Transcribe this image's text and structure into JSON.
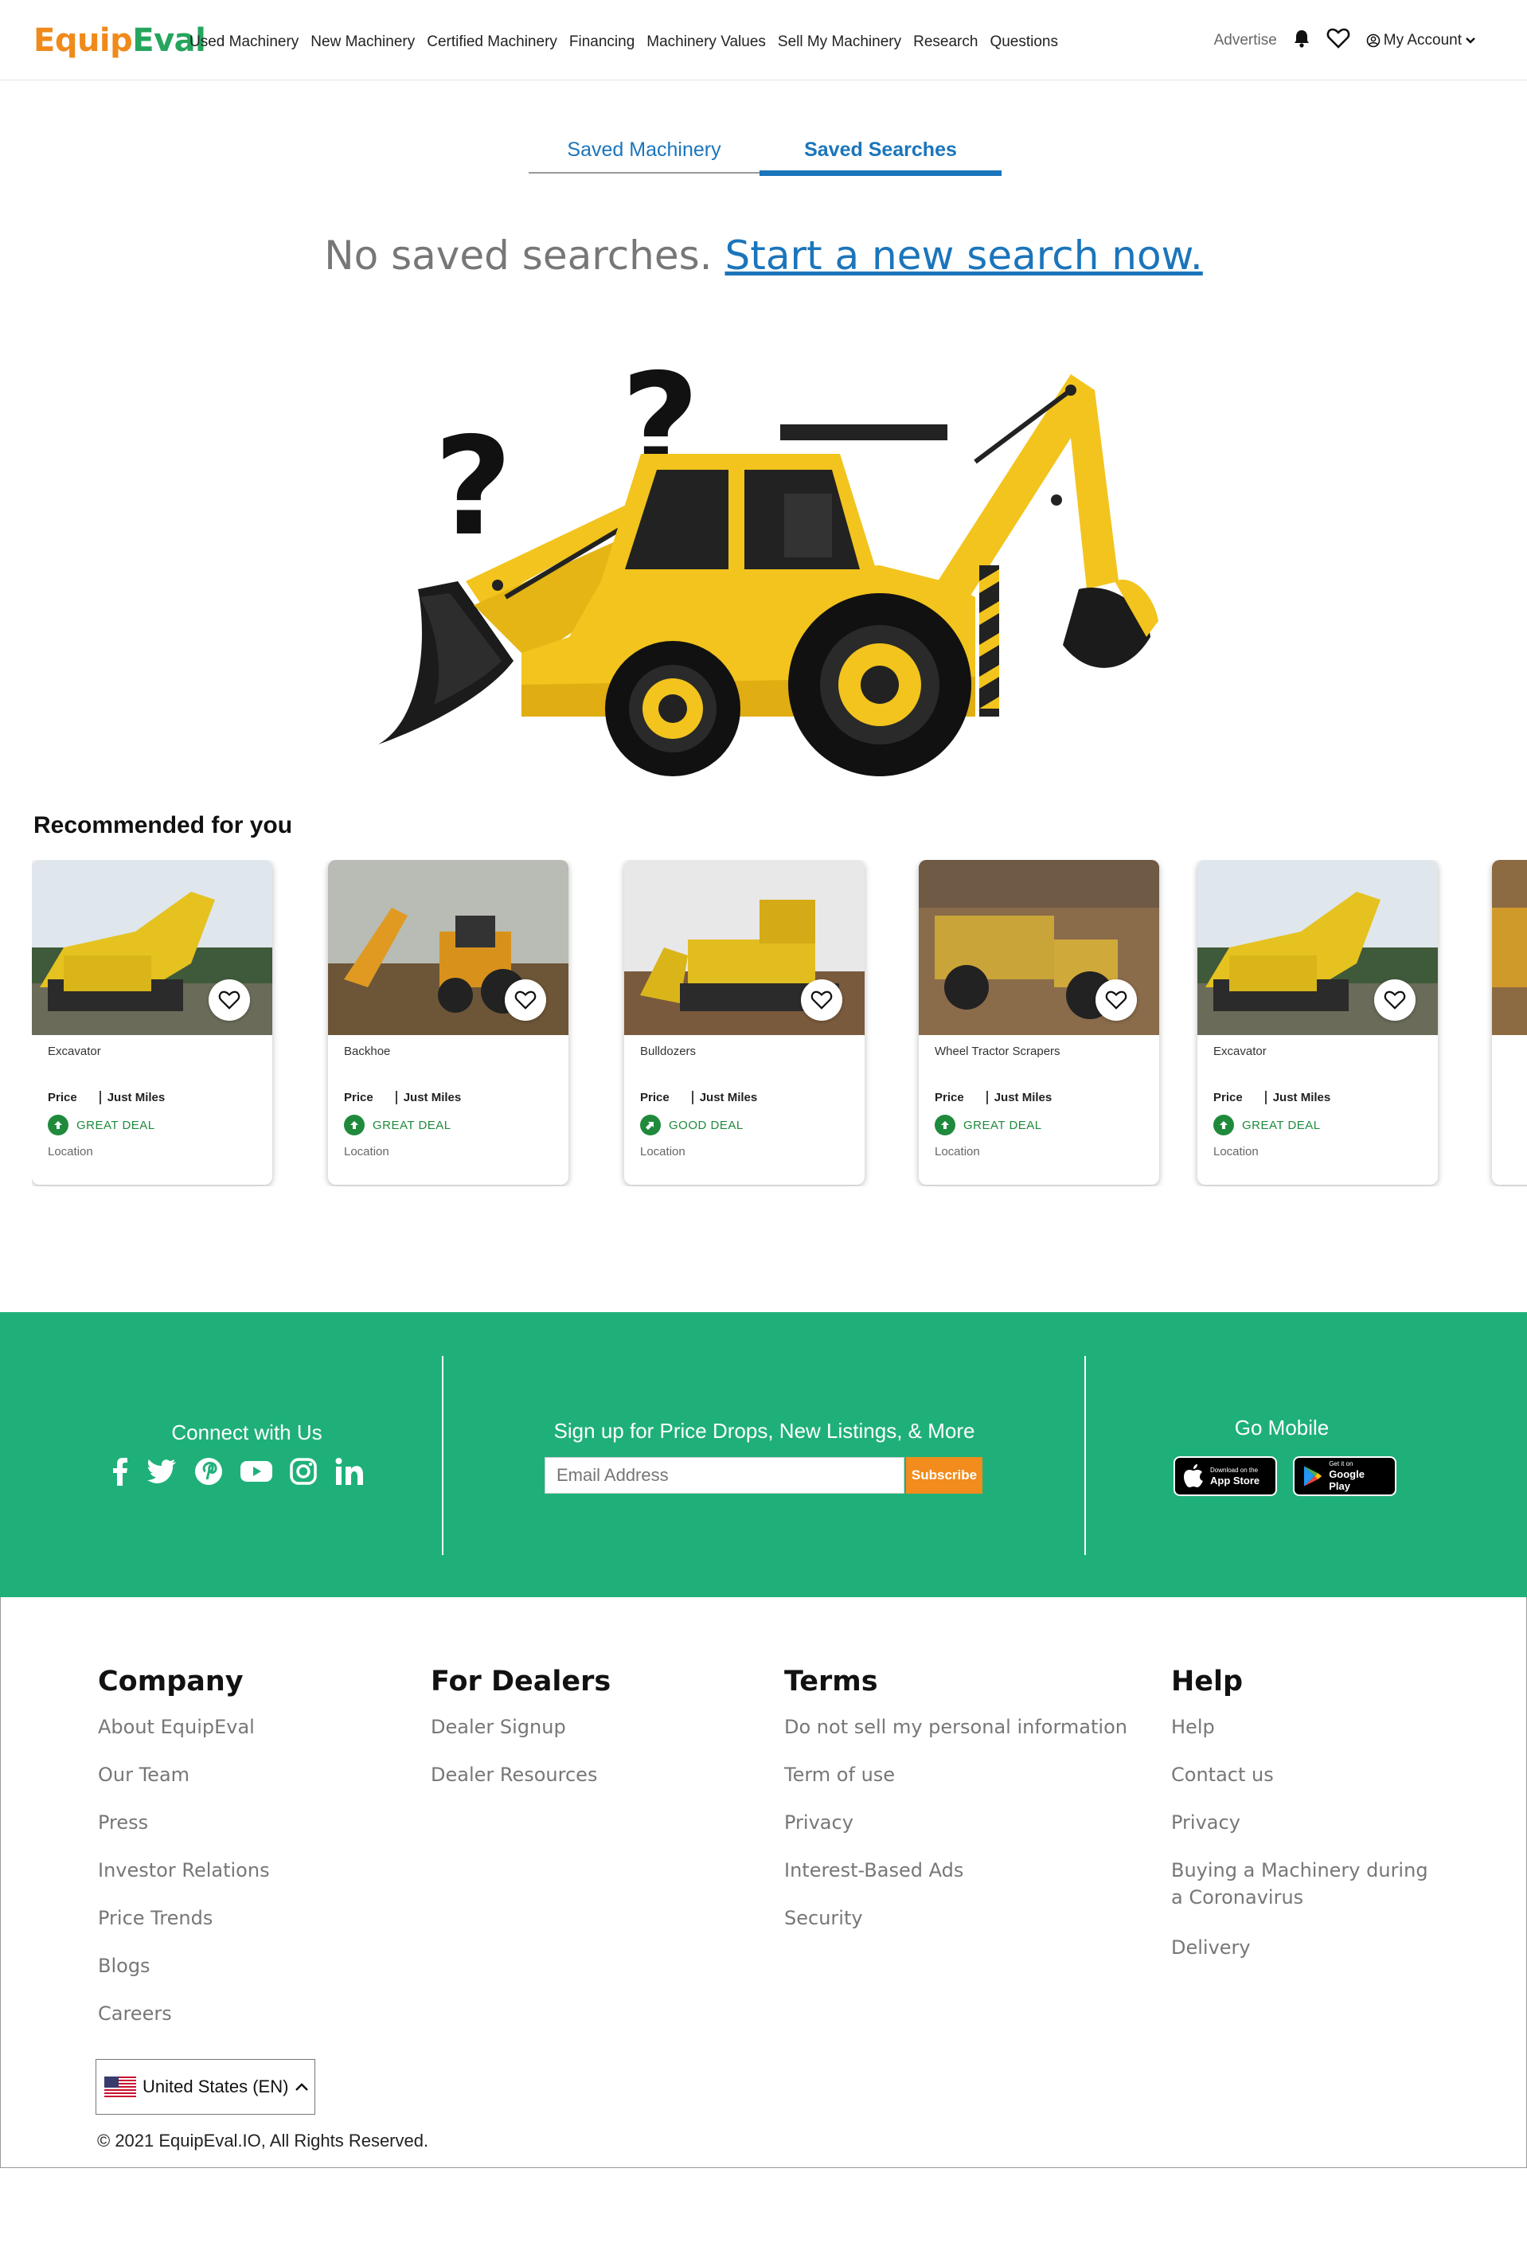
{
  "header": {
    "logo_part1": "Equip",
    "logo_part2": "Eval",
    "nav": [
      "Used Machinery",
      "New Machinery",
      "Certified Machinery",
      "Financing",
      "Machinery Values",
      "Sell My Machinery",
      "Research",
      "Questions"
    ],
    "advertise": "Advertise",
    "account": "My Account"
  },
  "tabs": {
    "saved_machinery": "Saved Machinery",
    "saved_searches": "Saved Searches"
  },
  "empty": {
    "message": "No saved searches.",
    "link": "Start a new search now."
  },
  "recommended": {
    "title": "Recommended for you",
    "price_label": "Price",
    "miles_label": "Just Miles",
    "location_label": "Location",
    "cards": [
      {
        "title": "Excavator",
        "deal": "GREAT DEAL"
      },
      {
        "title": "Backhoe",
        "deal": "GREAT DEAL"
      },
      {
        "title": "Bulldozers",
        "deal": "GOOD DEAL"
      },
      {
        "title": "Wheel Tractor Scrapers",
        "deal": "GREAT DEAL"
      },
      {
        "title": "Excavator",
        "deal": "GREAT DEAL"
      }
    ]
  },
  "band": {
    "connect": "Connect with Us",
    "signup": "Sign up for Price Drops, New Listings, & More",
    "email_placeholder": "Email Address",
    "subscribe": "Subscribe",
    "mobile": "Go Mobile",
    "app_store_small": "Download on the",
    "app_store_big": "App Store",
    "google_small": "Get it on",
    "google_big": "Google Play",
    "accent_color": "#1fb07a"
  },
  "footer": {
    "company": {
      "title": "Company",
      "links": [
        "About EquipEval",
        "Our Team",
        "Press",
        "Investor Relations",
        "Price Trends",
        "Blogs",
        "Careers"
      ]
    },
    "dealers": {
      "title": "For Dealers",
      "links": [
        "Dealer Signup",
        "Dealer Resources"
      ]
    },
    "terms": {
      "title": "Terms",
      "links": [
        "Do not sell my personal information",
        "Term of use",
        "Privacy",
        "Interest-Based Ads",
        "Security"
      ]
    },
    "help": {
      "title": "Help",
      "links": [
        "Help",
        "Contact us",
        "Privacy",
        "Buying a Machinery during a Coronavirus",
        "Delivery"
      ]
    },
    "language": "United States (EN)",
    "copyright": "© 2021 EquipEval.IO, All Rights Reserved."
  }
}
